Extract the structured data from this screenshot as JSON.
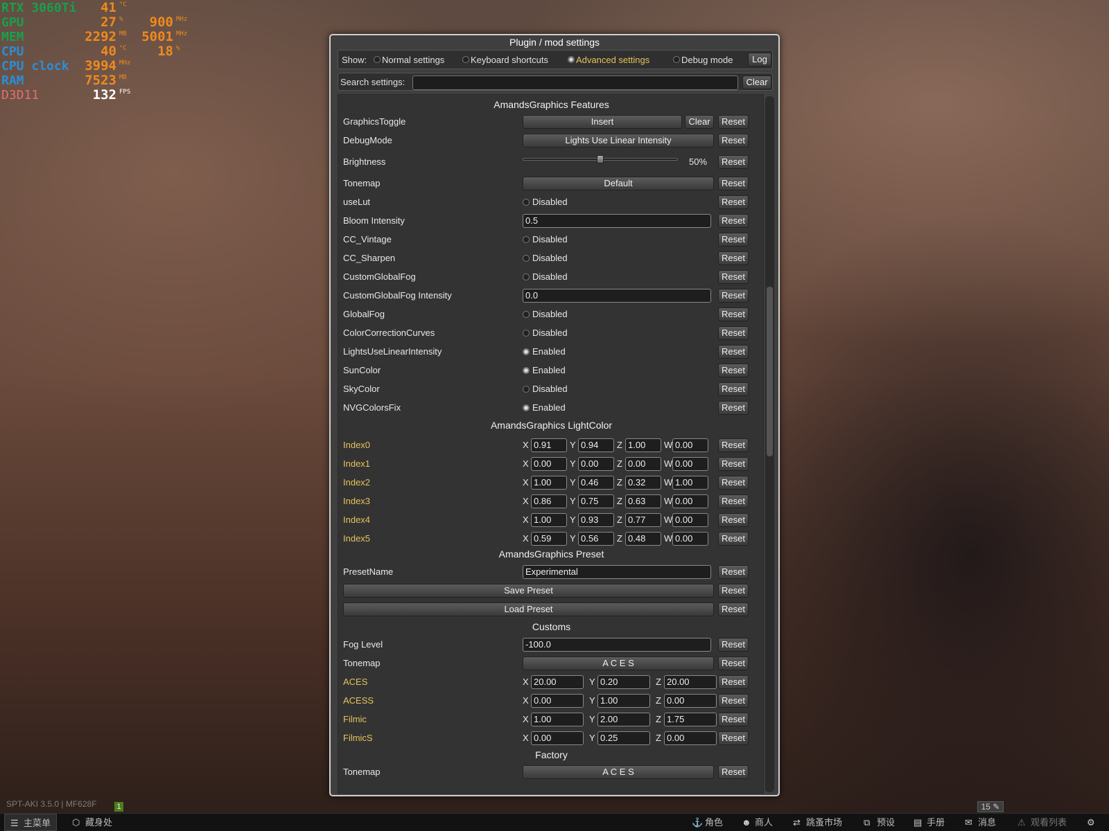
{
  "osd": {
    "gpu_name": "RTX 3060Ti",
    "gpu_temp": "41",
    "gpu_temp_unit": "°C",
    "gpu_label": "GPU",
    "gpu_load": "27",
    "gpu_load_unit": "%",
    "gpu_clock": "900",
    "gpu_clock_unit": "MHz",
    "mem_label": "MEM",
    "mem_used": "2292",
    "mem_used_unit": "MB",
    "mem_clock": "5001",
    "mem_clock_unit": "MHz",
    "cpu_label": "CPU",
    "cpu_temp": "40",
    "cpu_temp_unit": "°C",
    "cpu_load": "18",
    "cpu_load_unit": "%",
    "cpu_clock_label": "CPU clock",
    "cpu_clock": "3994",
    "cpu_clock_unit": "MHz",
    "ram_label": "RAM",
    "ram_used": "7523",
    "ram_used_unit": "MB",
    "api_label": "D3D11",
    "fps": "132",
    "fps_unit": "FPS"
  },
  "window": {
    "title": "Plugin / mod settings"
  },
  "show_bar": {
    "label": "Show:",
    "options": [
      "Normal settings",
      "Keyboard shortcuts",
      "Advanced settings",
      "Debug mode"
    ],
    "selected": "Advanced settings",
    "log_label": "Log"
  },
  "search": {
    "label": "Search settings:",
    "value": "",
    "clear_label": "Clear"
  },
  "common": {
    "reset": "Reset",
    "clear": "Clear"
  },
  "features": {
    "title": "AmandsGraphics Features",
    "graphics_toggle": {
      "label": "GraphicsToggle",
      "value": "Insert"
    },
    "debug_mode": {
      "label": "DebugMode",
      "value": "Lights Use Linear Intensity"
    },
    "brightness": {
      "label": "Brightness",
      "value": "50%",
      "level": 0.5
    },
    "tonemap": {
      "label": "Tonemap",
      "value": "Default"
    },
    "uselut": {
      "label": "useLut",
      "state": "Disabled"
    },
    "bloom_intensity": {
      "label": "Bloom Intensity",
      "value": "0.5"
    },
    "cc_vintage": {
      "label": "CC_Vintage",
      "state": "Disabled"
    },
    "cc_sharpen": {
      "label": "CC_Sharpen",
      "state": "Disabled"
    },
    "custom_global_fog": {
      "label": "CustomGlobalFog",
      "state": "Disabled"
    },
    "custom_global_fog_intensity": {
      "label": "CustomGlobalFog Intensity",
      "value": "0.0"
    },
    "global_fog": {
      "label": "GlobalFog",
      "state": "Disabled"
    },
    "color_correction_curves": {
      "label": "ColorCorrectionCurves",
      "state": "Disabled"
    },
    "lights_use_linear_intensity": {
      "label": "LightsUseLinearIntensity",
      "state": "Enabled"
    },
    "sun_color": {
      "label": "SunColor",
      "state": "Enabled"
    },
    "sky_color": {
      "label": "SkyColor",
      "state": "Disabled"
    },
    "nvg_colors_fix": {
      "label": "NVGColorsFix",
      "state": "Enabled"
    }
  },
  "light_color": {
    "title": "AmandsGraphics LightColor",
    "rows": [
      {
        "label": "Index0",
        "x": "0.91",
        "y": "0.94",
        "z": "1.00",
        "w": "0.00"
      },
      {
        "label": "Index1",
        "x": "0.00",
        "y": "0.00",
        "z": "0.00",
        "w": "0.00"
      },
      {
        "label": "Index2",
        "x": "1.00",
        "y": "0.46",
        "z": "0.32",
        "w": "1.00"
      },
      {
        "label": "Index3",
        "x": "0.86",
        "y": "0.75",
        "z": "0.63",
        "w": "0.00"
      },
      {
        "label": "Index4",
        "x": "1.00",
        "y": "0.93",
        "z": "0.77",
        "w": "0.00"
      },
      {
        "label": "Index5",
        "x": "0.59",
        "y": "0.56",
        "z": "0.48",
        "w": "0.00"
      }
    ]
  },
  "preset": {
    "title": "AmandsGraphics Preset",
    "preset_name": {
      "label": "PresetName",
      "value": "Experimental"
    },
    "save_label": "Save Preset",
    "load_label": "Load Preset"
  },
  "customs": {
    "title": "Customs",
    "fog_level": {
      "label": "Fog Level",
      "value": "-100.0"
    },
    "tonemap": {
      "label": "Tonemap",
      "value": "A C E S"
    },
    "rows": [
      {
        "label": "ACES",
        "x": "20.00",
        "y": "0.20",
        "z": "20.00"
      },
      {
        "label": "ACESS",
        "x": "0.00",
        "y": "1.00",
        "z": "0.00"
      },
      {
        "label": "Filmic",
        "x": "1.00",
        "y": "2.00",
        "z": "1.75"
      },
      {
        "label": "FilmicS",
        "x": "0.00",
        "y": "0.25",
        "z": "0.00"
      }
    ]
  },
  "factory": {
    "title": "Factory",
    "tonemap": {
      "label": "Tonemap",
      "value": "A C E S"
    }
  },
  "axes": {
    "x": "X",
    "y": "Y",
    "z": "Z",
    "w": "W"
  },
  "footer": {
    "version": "SPT-AKI 3.5.0 | MF628F",
    "version_badge": "1",
    "count": "15"
  },
  "taskbar": {
    "main_menu": "主菜单",
    "hideout": "藏身处",
    "character": "角色",
    "traders": "商人",
    "flea_market": "跳蚤市场",
    "presets": "预设",
    "handbook": "手册",
    "messages": "消息",
    "watchlist": "观看列表"
  }
}
